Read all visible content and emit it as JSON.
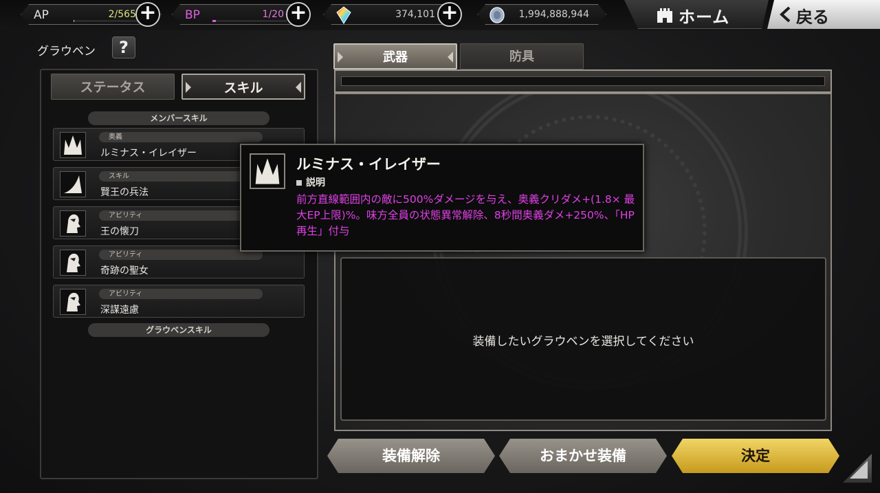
{
  "topbar": {
    "ap": {
      "label": "AP",
      "value": "2/565",
      "fill": 0.0035,
      "color": "#cfe07a"
    },
    "bp": {
      "label": "BP",
      "value": "1/20",
      "fill": 0.05,
      "color": "#e05fe0"
    },
    "crystal": {
      "value": "374,101",
      "icon": "rainbow-crystal-icon"
    },
    "coin": {
      "value": "1,994,888,944",
      "icon": "silver-coin-icon"
    },
    "plus": "+",
    "home": "ホーム",
    "back": "戻る"
  },
  "left": {
    "character_name": "グラウベン",
    "help": "?",
    "tabs": [
      "ステータス",
      "スキル"
    ],
    "active_tab": "スキル",
    "member_skill_header": "メンバースキル",
    "grauben_skill_header": "グラウベンスキル",
    "skills": [
      {
        "type": "奥義",
        "name": "ルミナス・イレイザー",
        "icon": "spikes-icon"
      },
      {
        "type": "スキル",
        "name": "賢王の兵法",
        "icon": "fang-icon"
      },
      {
        "type": "アビリティ",
        "name": "王の懐刀",
        "icon": "knight-head-icon"
      },
      {
        "type": "アビリティ",
        "name": "奇跡の聖女",
        "icon": "knight-head-icon"
      },
      {
        "type": "アビリティ",
        "name": "深謀遠慮",
        "icon": "knight-head-icon"
      }
    ]
  },
  "right": {
    "tabs": [
      "武器",
      "防具"
    ],
    "active_tab": "武器",
    "select_message": "装備したいグラウベンを選択してください"
  },
  "buttons": {
    "unequip": "装備解除",
    "auto_equip": "おまかせ装備",
    "confirm": "決定"
  },
  "tooltip": {
    "title": "ルミナス・イレイザー",
    "sub": "説明",
    "description": "前方直線範囲内の敵に500%ダメージを与え、奥義クリダメ+(1.8× 最大EP上限)%。味方全員の状態異常解除、8秒間奥義ダメ+250%、「HP再生」付与",
    "accent_color": "#e040e6"
  }
}
